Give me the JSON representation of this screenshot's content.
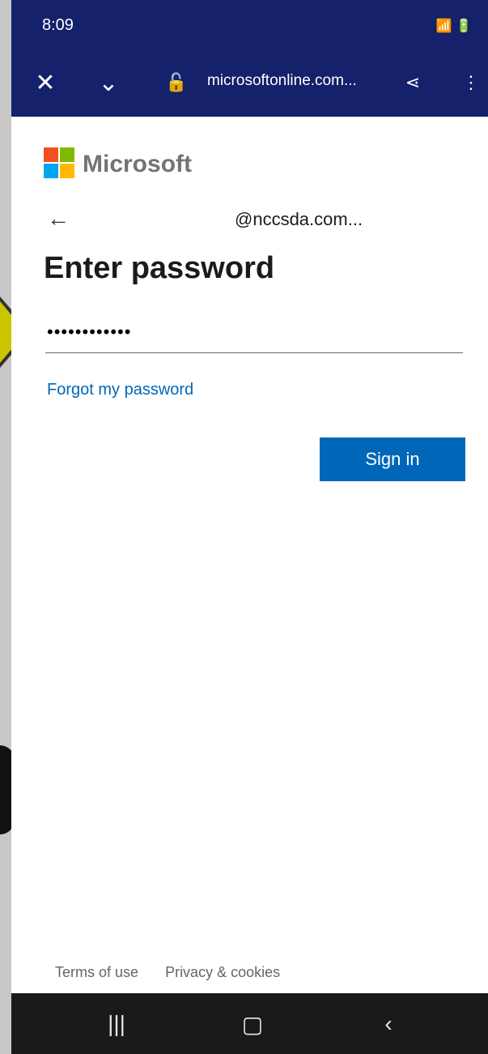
{
  "status_bar": {
    "time": "8:09",
    "icons": "📶 🔋"
  },
  "browser": {
    "url": "microsoftonline.com..."
  },
  "brand": {
    "wordmark": "Microsoft",
    "logo_colors": [
      "#f25022",
      "#7fba00",
      "#00a4ef",
      "#ffb900"
    ]
  },
  "identity": {
    "email": "@nccsda.com..."
  },
  "form": {
    "title": "Enter password",
    "password_value": "••••••••••••",
    "forgot_link": "Forgot my password",
    "sign_in_label": "Sign in"
  },
  "footer": {
    "terms": "Terms of use",
    "privacy": "Privacy & cookies"
  },
  "colors": {
    "accent": "#0067b8",
    "header_bg": "#15216a"
  }
}
